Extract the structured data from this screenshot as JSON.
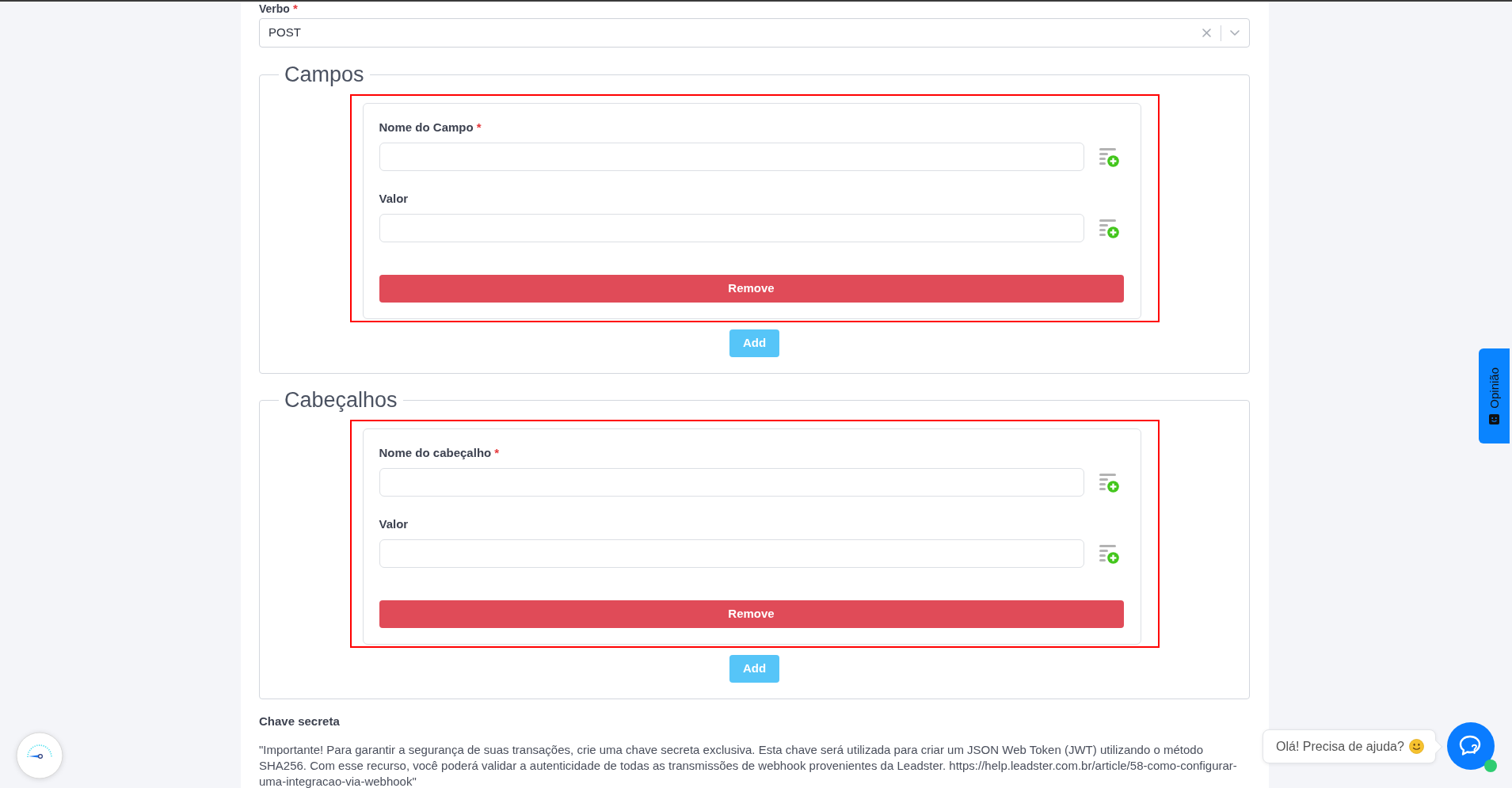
{
  "verb": {
    "label": "Verbo",
    "required_mark": "*",
    "value": "POST"
  },
  "sections": [
    {
      "legend": "Campos",
      "groups": [
        {
          "highlighted": true,
          "fields": [
            {
              "label": "Nome do Campo",
              "required_mark": "*"
            },
            {
              "label": "Valor"
            }
          ],
          "remove_button": "Remove"
        }
      ],
      "add_button": "Add"
    },
    {
      "legend": "Cabeçalhos",
      "groups": [
        {
          "highlighted": true,
          "fields": [
            {
              "label": "Nome do cabeçalho",
              "required_mark": "*"
            },
            {
              "label": "Valor"
            }
          ],
          "remove_button": "Remove"
        }
      ],
      "add_button": "Add"
    }
  ],
  "secret": {
    "label": "Chave secreta",
    "text": "\"Importante! Para garantir a segurança de suas transações, crie uma chave secreta exclusiva. Esta chave será utilizada para criar um JSON Web Token (JWT) utilizando o método SHA256. Com esse recurso, você poderá validar a autenticidade de todas as transmissões de webhook provenientes da Leadster. https://help.leadster.com.br/article/58-como-configurar-uma-integracao-via-webhook\""
  },
  "feedback_tab": {
    "label": "Opinião"
  },
  "chat": {
    "greeting": "Olá! Precisa de ajuda?"
  }
}
